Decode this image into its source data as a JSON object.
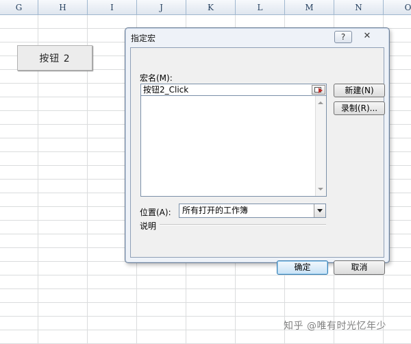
{
  "spreadsheet": {
    "columns": [
      "G",
      "H",
      "I",
      "J",
      "K",
      "L",
      "M",
      "N",
      "O"
    ],
    "button_label": "按钮 2"
  },
  "dialog": {
    "title": "指定宏",
    "help_label": "?",
    "close_label": "✕",
    "macro_name_label": "宏名(M):",
    "macro_name_value": "按钮2_Click",
    "macro_list_items": [],
    "new_button_label": "新建(N)",
    "record_button_label": "录制(R)...",
    "location_label": "位置(A):",
    "location_value": "所有打开的工作簿",
    "description_label": "说明",
    "ok_label": "确定",
    "cancel_label": "取消"
  },
  "watermark": "知乎 @唯有时光忆年少",
  "colors": {
    "header_text": "#27415f",
    "gridline": "#dadcdd",
    "dialog_bg": "#eef2f8",
    "default_button_border": "#3c7fb1"
  },
  "icons": {
    "pick_cell": "range-select-icon",
    "dropdown": "chevron-down-icon"
  }
}
